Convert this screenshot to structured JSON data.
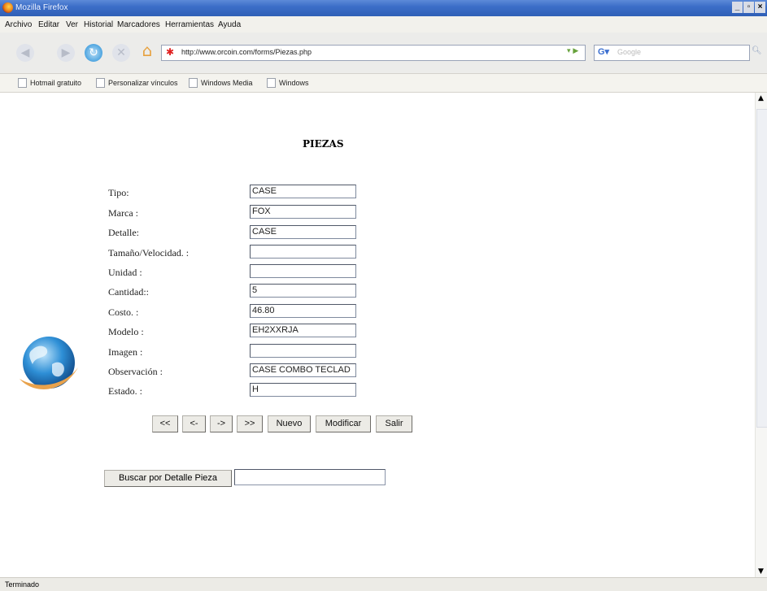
{
  "window": {
    "title": "Mozilla Firefox"
  },
  "menu": [
    "Archivo",
    "Editar",
    "Ver",
    "Historial",
    "Marcadores",
    "Herramientas",
    "Ayuda"
  ],
  "navigation": {
    "url": "http://www.orcoin.com/forms/Piezas.php",
    "search_placeholder": "Google"
  },
  "bookmarks": [
    "Hotmail gratuito",
    "Personalizar vínculos",
    "Windows Media",
    "Windows"
  ],
  "page": {
    "title": "PIEZAS",
    "fields": [
      {
        "label": "Tipo:",
        "value": "CASE"
      },
      {
        "label": "Marca :",
        "value": "FOX"
      },
      {
        "label": "Detalle:",
        "value": "CASE"
      },
      {
        "label": "Tamaño/Velocidad. :",
        "value": ""
      },
      {
        "label": "Unidad :",
        "value": ""
      },
      {
        "label": "Cantidad::",
        "value": "5"
      },
      {
        "label": "Costo. :",
        "value": "46.80"
      },
      {
        "label": "Modelo :",
        "value": "EH2XXRJA"
      },
      {
        "label": "Imagen :",
        "value": ""
      },
      {
        "label": "Observación :",
        "value": "CASE COMBO TECLAD"
      },
      {
        "label": "Estado. :",
        "value": "H"
      }
    ],
    "buttons": {
      "first": "<<",
      "prev": "<-",
      "next": "->",
      "last": ">>",
      "new": "Nuevo",
      "modify": "Modificar",
      "exit": "Salir"
    },
    "search_button": "Buscar por Detalle Pieza",
    "search_value": ""
  },
  "status": "Terminado",
  "colors": {
    "titlebar": "#3c6ec8",
    "chrome": "#ecebe6"
  }
}
